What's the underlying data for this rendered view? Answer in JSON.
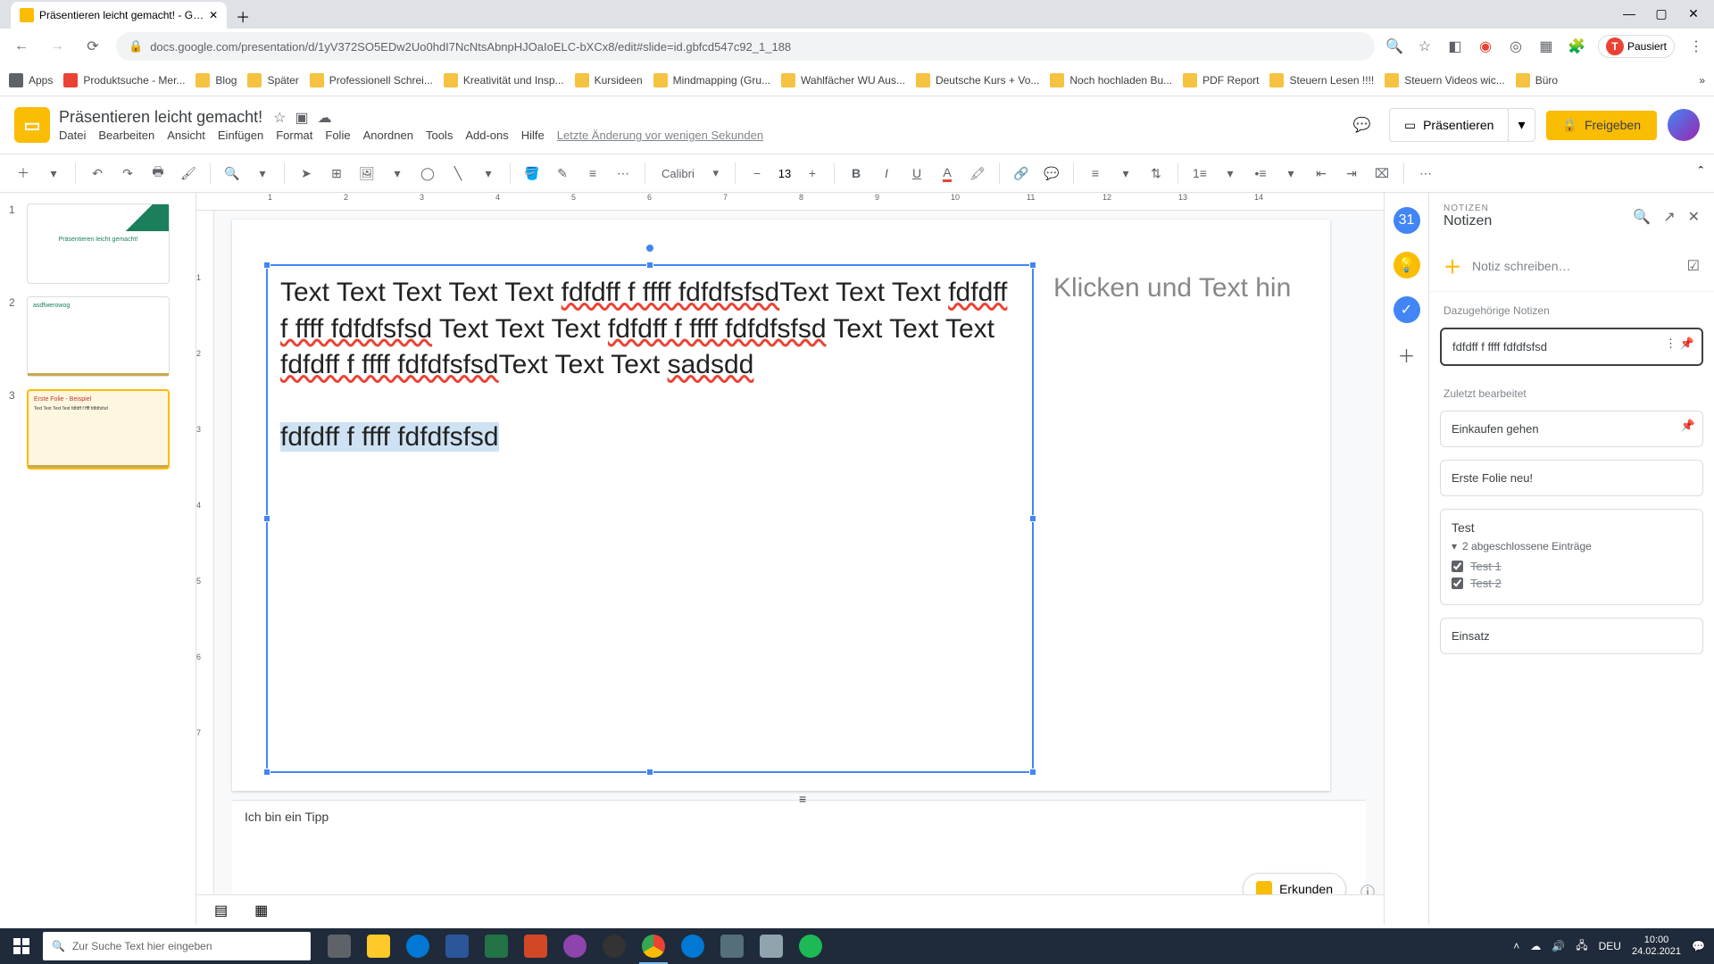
{
  "browser": {
    "tab_title": "Präsentieren leicht gemacht! - G…",
    "url": "docs.google.com/presentation/d/1yV372SO5EDw2Uo0hdI7NcNtsAbnpHJOaIoELC-bXCx8/edit#slide=id.gbfcd547c92_1_188",
    "profile_status": "Pausiert",
    "profile_initial": "T"
  },
  "bookmarks": {
    "apps": "Apps",
    "items": [
      "Produktsuche - Mer...",
      "Blog",
      "Später",
      "Professionell Schrei...",
      "Kreativität und Insp...",
      "Kursideen",
      "Mindmapping  (Gru...",
      "Wahlfächer WU Aus...",
      "Deutsche Kurs + Vo...",
      "Noch hochladen Bu...",
      "PDF Report",
      "Steuern Lesen !!!!",
      "Steuern Videos wic...",
      "Büro"
    ]
  },
  "doc": {
    "title": "Präsentieren leicht gemacht!",
    "menus": [
      "Datei",
      "Bearbeiten",
      "Ansicht",
      "Einfügen",
      "Format",
      "Folie",
      "Anordnen",
      "Tools",
      "Add-ons",
      "Hilfe"
    ],
    "last_edit": "Letzte Änderung vor wenigen Sekunden",
    "present": "Präsentieren",
    "share": "Freigeben"
  },
  "toolbar": {
    "font": "Calibri",
    "font_size": "13"
  },
  "slides": [
    "1",
    "2",
    "3"
  ],
  "slide_thumbs": {
    "t1": "Präsentieren leicht gemacht!",
    "t2": "asdfwerowog",
    "t3_title": "Erste Folie - Beispiel",
    "t3_body": "Text Text Text Text fdfdff f ffff fdfdfsfsd"
  },
  "canvas": {
    "body_text_1": "Text Text Text Text Text ",
    "err1": "fdfdff f ffff fdfdfsfsd",
    "body_text_2": "Text Text Text ",
    "err2": "fdfdff f ffff fdfdfsfsd",
    "body_text_3": " Text Text Text ",
    "err3": "fdfdff f ffff fdfdfsfsd",
    "body_text_4": " Text Text Text ",
    "err4": "fdfdff f ffff fdfdfsfsd",
    "body_text_5": "Text Text Text ",
    "err5": "sadsdd",
    "highlighted_line": "fdfdff f ffff fdfdfsfsd",
    "placeholder": "Klicken und Text hin",
    "speaker_notes": "Ich bin ein Tipp"
  },
  "explore": "Erkunden",
  "keep": {
    "eyebrow": "NOTIZEN",
    "title": "Notizen",
    "new_note": "Notiz schreiben…",
    "section_related": "Dazugehörige Notizen",
    "related_note": "fdfdff f ffff fdfdfsfsd",
    "section_recent": "Zuletzt bearbeitet",
    "recent_notes": [
      "Einkaufen gehen",
      "Erste Folie neu!"
    ],
    "test_title": "Test",
    "completed_label": "2 abgeschlossene Einträge",
    "check_items": [
      "Test 1",
      "Test 2"
    ],
    "einsatz": "Einsatz"
  },
  "ruler": [
    "1",
    "2",
    "3",
    "4",
    "5",
    "6",
    "7",
    "8",
    "9",
    "10",
    "11",
    "12",
    "13",
    "14"
  ],
  "ruler_v": [
    "1",
    "2",
    "3",
    "4",
    "5",
    "6",
    "7"
  ],
  "taskbar": {
    "search_placeholder": "Zur Suche Text hier eingeben",
    "lang": "DEU",
    "time": "10:00",
    "date": "24.02.2021"
  }
}
